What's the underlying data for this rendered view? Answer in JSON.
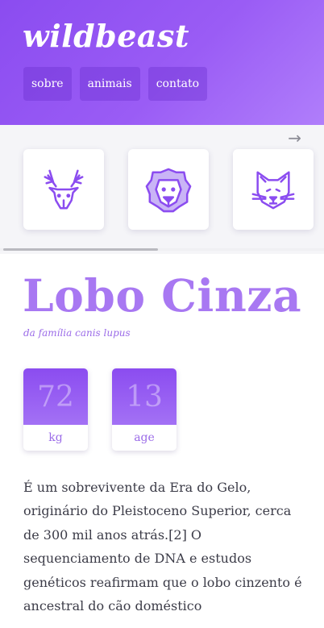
{
  "header": {
    "logo": "wildbeast",
    "nav": [
      {
        "label": "sobre"
      },
      {
        "label": "animais"
      },
      {
        "label": "contato"
      }
    ]
  },
  "carousel": {
    "next_arrow": "→",
    "cards": [
      {
        "icon": "deer-icon"
      },
      {
        "icon": "lion-icon"
      },
      {
        "icon": "cat-icon"
      }
    ],
    "scroll_position": 0.0
  },
  "animal": {
    "name": "Lobo Cinza",
    "family": "da família canis lupus",
    "stats": [
      {
        "value": "72",
        "label": "kg"
      },
      {
        "value": "13",
        "label": "age"
      }
    ],
    "description": "É um sobrevivente da Era do Gelo, originário do Pleistoceno Superior, cerca de 300 mil anos atrás.[2] O sequenciamento de DNA e estudos genéticos reafirmam que o lobo cinzento é ancestral do cão doméstico"
  },
  "colors": {
    "accent": "#9b6be8",
    "header_gradient_start": "#8b4cf0",
    "header_gradient_end": "#b07efb",
    "icon_stroke": "#8b4cf0"
  }
}
